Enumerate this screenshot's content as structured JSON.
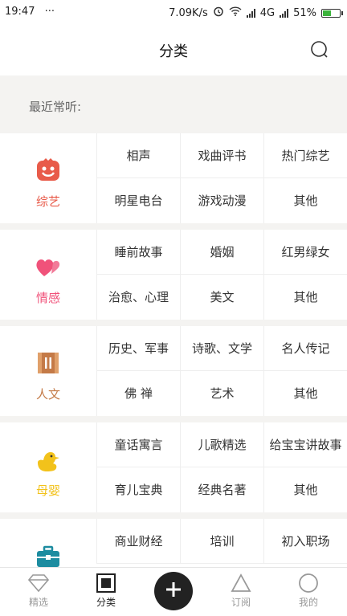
{
  "status_bar": {
    "time": "19:47",
    "dots": "···",
    "speed": "7.09K/s",
    "network": "4G",
    "battery_percent": "51%",
    "battery_level": 0.51
  },
  "header": {
    "title": "分类",
    "search_icon": "search-icon"
  },
  "recent": {
    "label": "最近常听:"
  },
  "categories": [
    {
      "name": "综艺",
      "color": "#e85b4a",
      "icon": "smiley-face-icon",
      "items": [
        "相声",
        "戏曲评书",
        "热门综艺",
        "明星电台",
        "游戏动漫",
        "其他"
      ]
    },
    {
      "name": "情感",
      "color": "#f0527a",
      "icon": "hearts-icon",
      "items": [
        "睡前故事",
        "婚姻",
        "红男绿女",
        "治愈、心理",
        "美文",
        "其他"
      ]
    },
    {
      "name": "人文",
      "color": "#c47a47",
      "icon": "scroll-icon",
      "items": [
        "历史、军事",
        "诗歌、文学",
        "名人传记",
        "佛 禅",
        "艺术",
        "其他"
      ]
    },
    {
      "name": "母婴",
      "color": "#f2c21b",
      "icon": "duck-icon",
      "items": [
        "童话寓言",
        "儿歌精选",
        "给宝宝讲故事",
        "育儿宝典",
        "经典名著",
        "其他"
      ]
    },
    {
      "name": "",
      "color": "#1d8ca0",
      "icon": "briefcase-icon",
      "items": [
        "商业财经",
        "培训",
        "初入职场"
      ]
    }
  ],
  "tabbar": {
    "tabs": [
      {
        "label": "精选",
        "icon": "diamond-icon"
      },
      {
        "label": "分类",
        "icon": "square-icon"
      },
      {
        "label": "订阅",
        "icon": "triangle-icon"
      },
      {
        "label": "我的",
        "icon": "circle-icon"
      }
    ],
    "add_icon": "plus-icon"
  }
}
